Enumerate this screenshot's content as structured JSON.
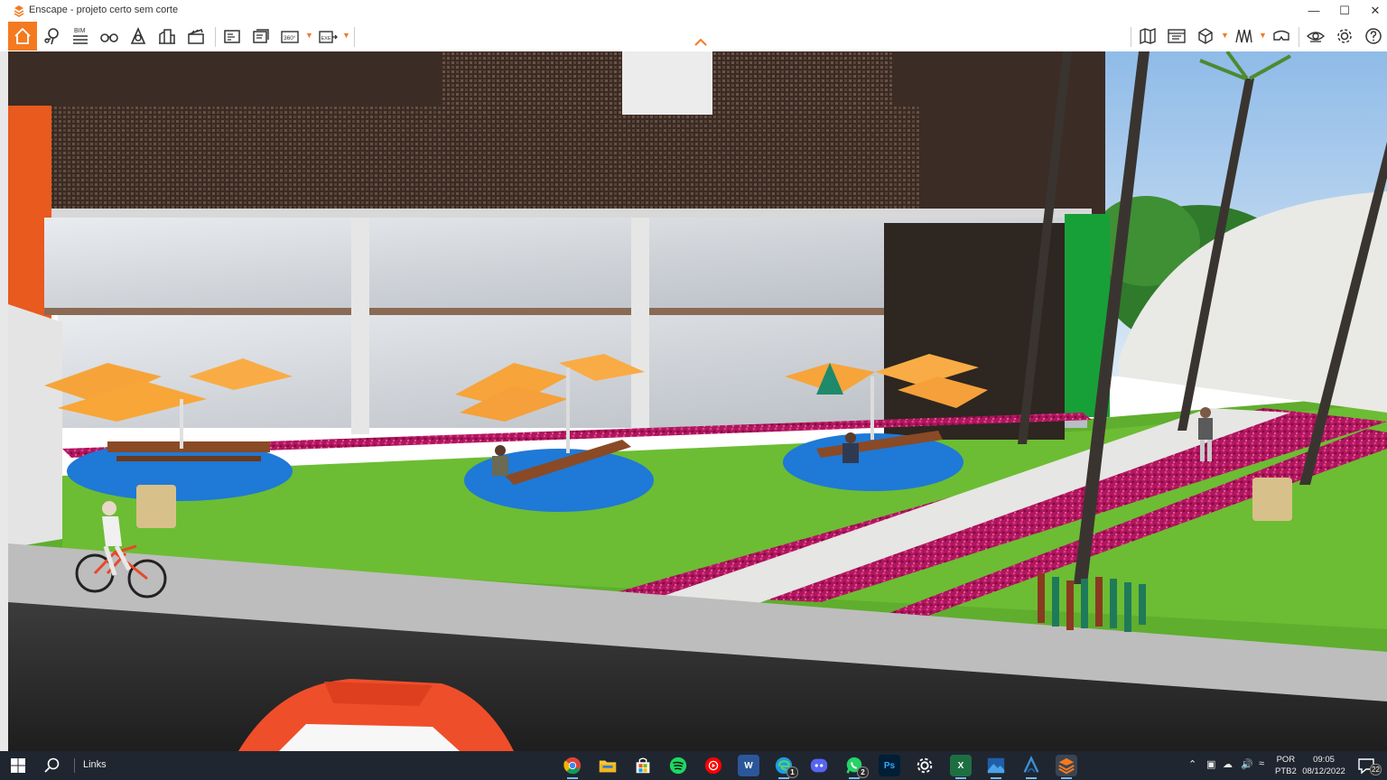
{
  "window": {
    "title": "Enscape - projeto certo sem corte",
    "logo_icon": "enscape-logo-icon",
    "controls": [
      "minimize-icon",
      "maximize-icon",
      "close-icon"
    ]
  },
  "toolbar": {
    "bim_label": "BIM",
    "tool_360_label": "360°",
    "tool_exe_label": "EXE",
    "left_tools": [
      "home-icon",
      "location-icon",
      "bim-list-icon",
      "binoculars-icon",
      "sun-icon",
      "buildings-icon",
      "clapboard-icon",
      "screenshot-icon",
      "batch-render-icon",
      "panorama-360-icon",
      "export-exe-icon"
    ],
    "right_tools": [
      "map-icon",
      "asset-library-icon",
      "cube-view-icon",
      "bookmarks-icon",
      "vr-headset-icon",
      "visibility-eye-icon",
      "settings-gear-icon",
      "help-icon"
    ],
    "accent_color": "#f47a20"
  },
  "taskbar": {
    "links_label": "Links",
    "apps": [
      "chrome-icon",
      "file-explorer-icon",
      "microsoft-store-icon",
      "spotify-icon",
      "youtube-music-icon",
      "word-icon",
      "edge-icon",
      "discord-icon",
      "whatsapp-icon",
      "photoshop-icon",
      "settings-icon",
      "excel-icon",
      "photos-icon",
      "sketchup-icon",
      "enscape-icon"
    ],
    "edge_badge": "1",
    "whatsapp_badge": "2",
    "photoshop_label": "Ps",
    "word_label": "W",
    "excel_label": "X",
    "lang_top": "POR",
    "lang_bottom": "PTB2",
    "time": "09:05",
    "date": "08/12/2022",
    "notification_count": "22",
    "tray_icons": [
      "chevron-up-icon",
      "meet-now-icon",
      "onedrive-icon",
      "volume-icon",
      "wifi-icon"
    ]
  }
}
